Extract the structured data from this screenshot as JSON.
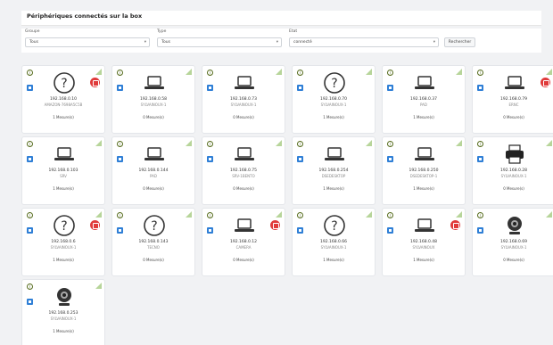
{
  "header": {
    "title": "Périphériques connectés sur la box"
  },
  "filters": {
    "groupe": {
      "label": "Groupe",
      "value": "Tous"
    },
    "type": {
      "label": "Type",
      "value": "Tous"
    },
    "etat": {
      "label": "Etat",
      "value": "connecté"
    },
    "button": "Rechercher"
  },
  "devices": [
    {
      "icon": "question",
      "ip": "192.168.0.10",
      "name": "AMAZON-7698A5C5B",
      "measures": "1 Mesure(s)",
      "alert": true
    },
    {
      "icon": "laptop",
      "ip": "192.168.0.58",
      "name": "SYLVAINOUX-1",
      "measures": "0 Mesure(s)",
      "alert": false
    },
    {
      "icon": "laptop",
      "ip": "192.168.0.73",
      "name": "SYLVAINOUX-1",
      "measures": "0 Mesure(s)",
      "alert": false
    },
    {
      "icon": "question",
      "ip": "192.168.0.70",
      "name": "SYLVAINOUX-1",
      "measures": "1 Mesure(s)",
      "alert": false
    },
    {
      "icon": "laptop",
      "ip": "192.168.0.37",
      "name": "PAD",
      "measures": "1 Mesure(s)",
      "alert": false
    },
    {
      "icon": "laptop",
      "ip": "192.168.0.79",
      "name": "ERNC",
      "measures": "0 Mesure(s)",
      "alert": true
    },
    {
      "icon": "laptop",
      "ip": "192.168.0.103",
      "name": "SRV",
      "measures": "1 Mesure(s)",
      "alert": false
    },
    {
      "icon": "laptop",
      "ip": "192.168.0.144",
      "name": "PAD",
      "measures": "0 Mesure(s)",
      "alert": false
    },
    {
      "icon": "laptop",
      "ip": "192.168.0.75",
      "name": "SRV-1BENTO",
      "measures": "0 Mesure(s)",
      "alert": false
    },
    {
      "icon": "laptop",
      "ip": "192.168.0.254",
      "name": "DSEDESKTOP",
      "measures": "1 Mesure(s)",
      "alert": false
    },
    {
      "icon": "laptop",
      "ip": "192.168.0.250",
      "name": "DSEDESKTOP-1",
      "measures": "1 Mesure(s)",
      "alert": false
    },
    {
      "icon": "printer",
      "ip": "192.168.0.28",
      "name": "SYLVAINOUX-1",
      "measures": "0 Mesure(s)",
      "alert": false
    },
    {
      "icon": "question",
      "ip": "192.168.0.6",
      "name": "SYLVAINOUX-1",
      "measures": "1 Mesure(s)",
      "alert": true
    },
    {
      "icon": "question",
      "ip": "192.168.0.143",
      "name": "TECNO",
      "measures": "0 Mesure(s)",
      "alert": false
    },
    {
      "icon": "laptop",
      "ip": "192.168.0.12",
      "name": "CAMERA",
      "measures": "0 Mesure(s)",
      "alert": true
    },
    {
      "icon": "question",
      "ip": "192.168.0.66",
      "name": "SYLVAINOUX-1",
      "measures": "1 Mesure(s)",
      "alert": false
    },
    {
      "icon": "laptop",
      "ip": "192.168.0.48",
      "name": "SYLVAINOUX",
      "measures": "1 Mesure(s)",
      "alert": true
    },
    {
      "icon": "webcam",
      "ip": "192.168.0.69",
      "name": "SYLVAINOUX-1",
      "measures": "0 Mesure(s)",
      "alert": false
    },
    {
      "icon": "webcam",
      "ip": "192.168.0.253",
      "name": "SYLVAINOUX-1",
      "measures": "1 Mesure(s)",
      "alert": false
    }
  ]
}
